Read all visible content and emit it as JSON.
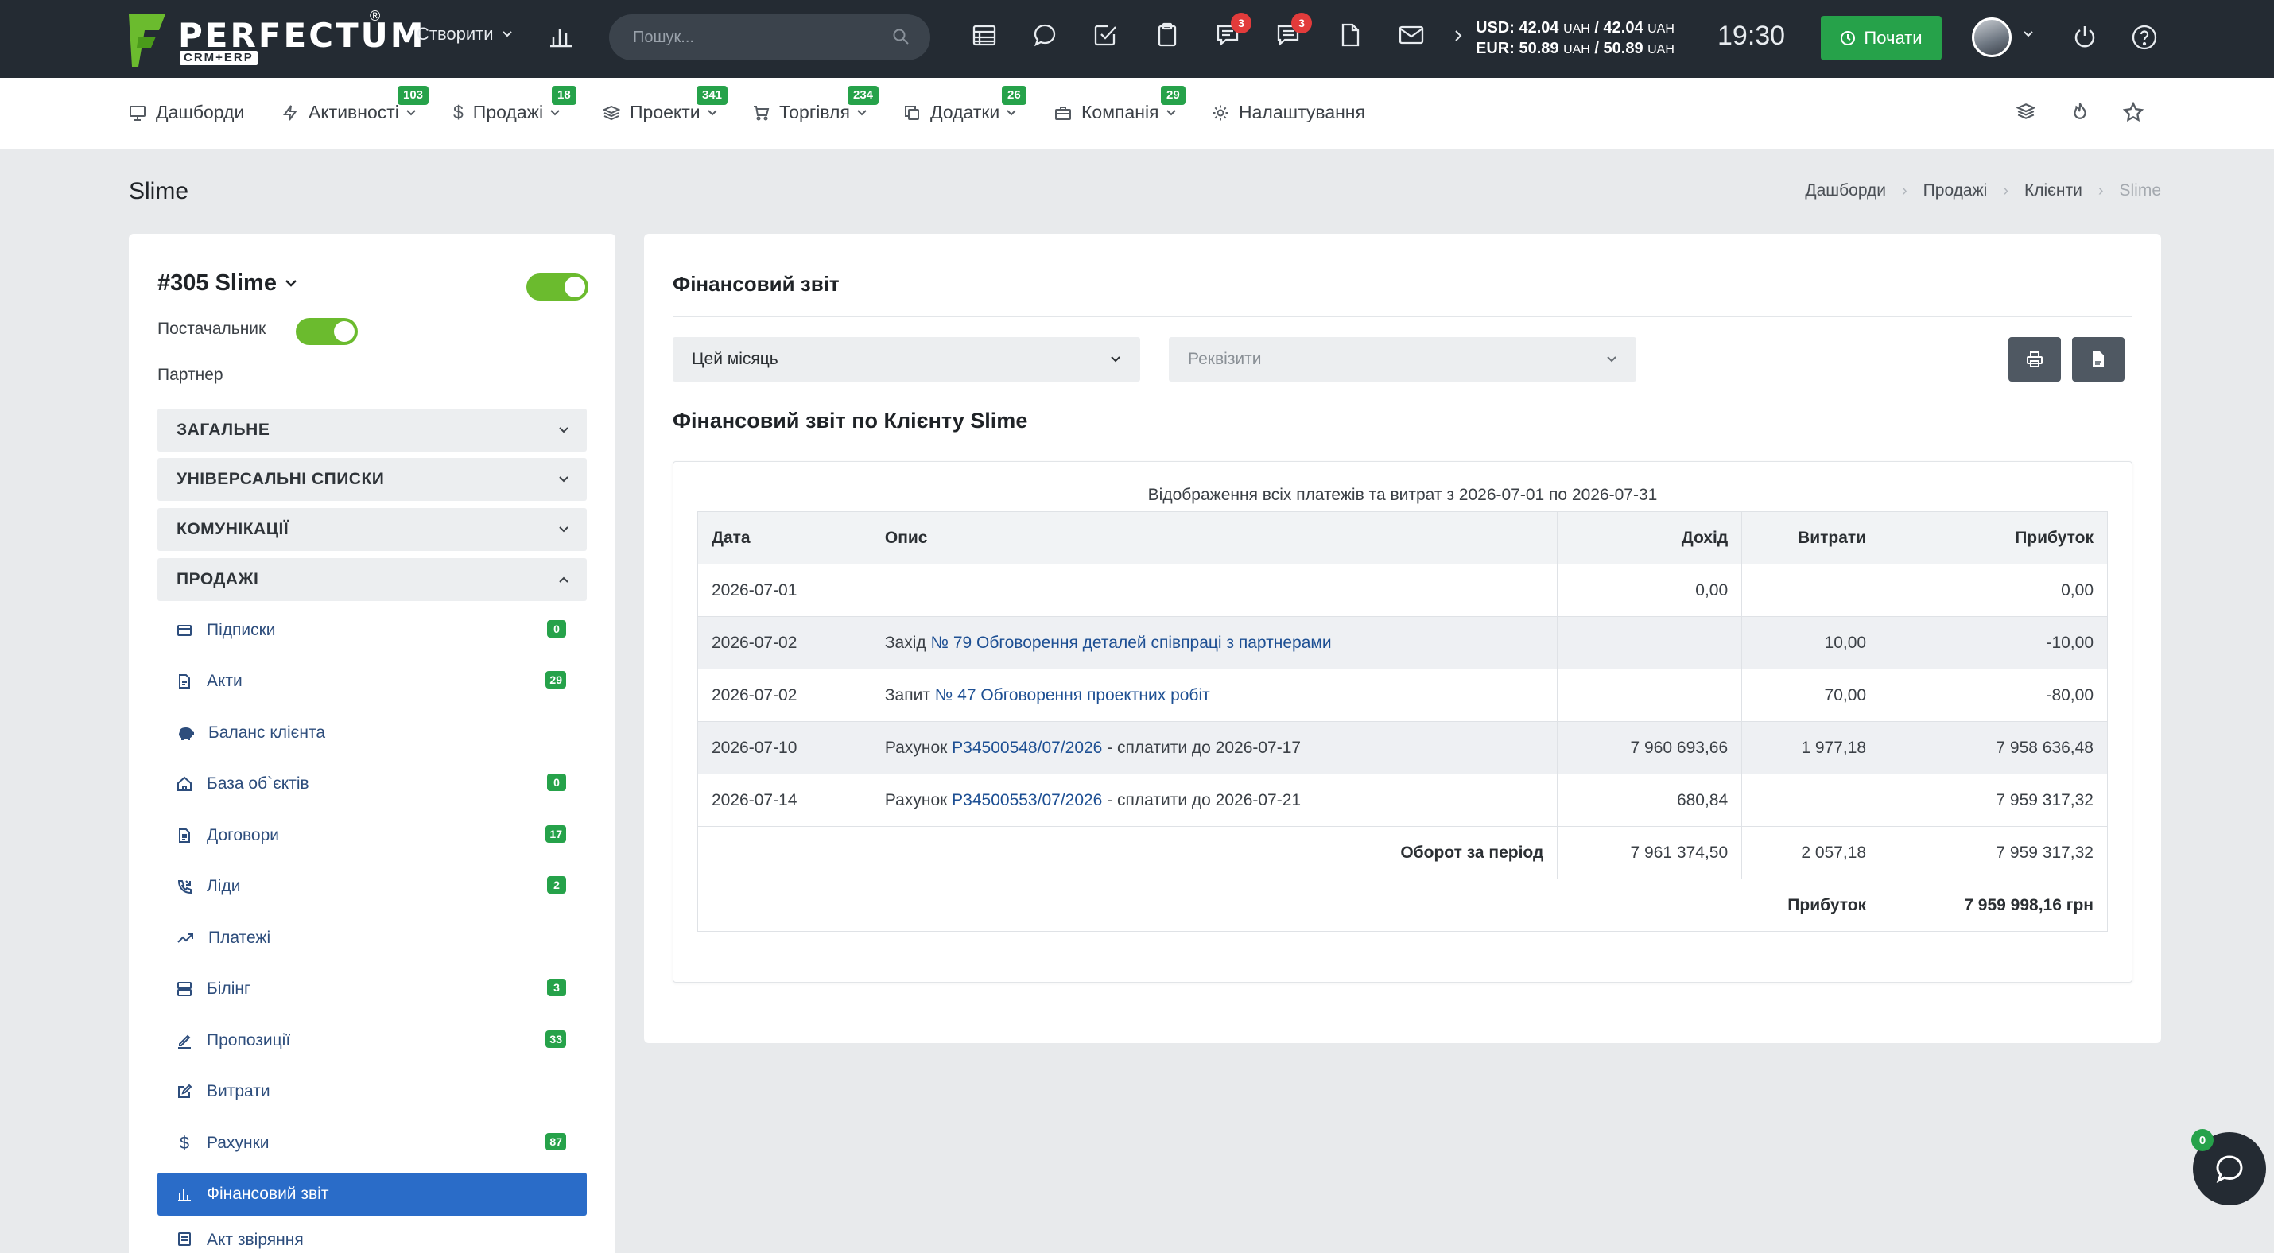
{
  "topbar": {
    "brand": "PERFECTUM",
    "brand_reg": "®",
    "brand_sub": "CRM+ERP",
    "create_label": "Створити",
    "search_placeholder": "Пошук...",
    "badges": {
      "notifications": "3",
      "messages": "3"
    },
    "currency_usd": "USD: 42.04",
    "currency_usd_rest": " / 42.04 ",
    "currency_eur": "EUR: 50.89",
    "currency_eur_rest": " / 50.89 ",
    "currency_unit": "UAH",
    "clock": "19:30",
    "start_label": "Почати",
    "colors": {
      "bg": "#242b33",
      "accent": "#26a24a",
      "badge": "#e23b3b"
    }
  },
  "nav": {
    "items": [
      {
        "label": "Дашборди",
        "icon": "monitor-icon",
        "badge": ""
      },
      {
        "label": "Активності",
        "icon": "bolt-icon",
        "badge": "103"
      },
      {
        "label": "Продажі",
        "icon": "dollar-icon",
        "badge": "18"
      },
      {
        "label": "Проекти",
        "icon": "layers-icon",
        "badge": "341"
      },
      {
        "label": "Торгівля",
        "icon": "cart-icon",
        "badge": "234"
      },
      {
        "label": "Додатки",
        "icon": "copy-icon",
        "badge": "26"
      },
      {
        "label": "Компанія",
        "icon": "briefcase-icon",
        "badge": "29"
      },
      {
        "label": "Налаштування",
        "icon": "gear-icon",
        "badge": ""
      }
    ]
  },
  "page": {
    "title": "Slime",
    "breadcrumb": [
      "Дашборди",
      "Продажі",
      "Клієнти",
      "Slime"
    ]
  },
  "client": {
    "name": "#305 Slime",
    "supplier_label": "Постачальник",
    "partner_label": "Партнер",
    "sections": [
      "ЗАГАЛЬНЕ",
      "УНІВЕРСАЛЬНІ СПИСКИ",
      "КОМУНІКАЦІЇ",
      "ПРОДАЖІ"
    ],
    "sales_items": [
      {
        "label": "Підписки",
        "badge": "0",
        "icon": "subscription-icon"
      },
      {
        "label": "Акти",
        "badge": "29",
        "icon": "document-icon"
      },
      {
        "label": "Баланс клієнта",
        "badge": "",
        "icon": "piggy-bank-icon"
      },
      {
        "label": "База об`єктів",
        "badge": "0",
        "icon": "home-icon"
      },
      {
        "label": "Договори",
        "badge": "17",
        "icon": "contract-icon"
      },
      {
        "label": "Ліди",
        "badge": "2",
        "icon": "phone-icon"
      },
      {
        "label": "Платежі",
        "badge": "",
        "icon": "trend-up-icon"
      },
      {
        "label": "Білінг",
        "badge": "3",
        "icon": "server-icon"
      },
      {
        "label": "Пропозиції",
        "badge": "33",
        "icon": "pen-icon"
      },
      {
        "label": "Витрати",
        "badge": "",
        "icon": "edit-icon"
      },
      {
        "label": "Рахунки",
        "badge": "87",
        "icon": "dollar-icon"
      },
      {
        "label": "Фінансовий звіт",
        "badge": "",
        "icon": "chart-icon"
      },
      {
        "label": "Акт звіряння",
        "badge": "",
        "icon": "list-icon"
      }
    ]
  },
  "report": {
    "title": "Фінансовий звіт",
    "period_value": "Цей місяць",
    "requisites_placeholder": "Реквізити",
    "subtitle": "Фінансовий звіт по Клієнту Slime",
    "caption": "Відображення всіх платежів та витрат з 2026-07-01 по 2026-07-31",
    "columns": [
      "Дата",
      "Опис",
      "Дохід",
      "Витрати",
      "Прибуток"
    ],
    "rows": [
      {
        "date": "2026-07-01",
        "desc_prefix": "",
        "desc_link": "",
        "desc_suffix": "",
        "income": "0,00",
        "expense": "",
        "profit": "0,00"
      },
      {
        "date": "2026-07-02",
        "desc_prefix": "Захід ",
        "desc_link": "№ 79 Обговорення деталей співпраці з партнерами",
        "desc_suffix": "",
        "income": "",
        "expense": "10,00",
        "profit": "-10,00"
      },
      {
        "date": "2026-07-02",
        "desc_prefix": "Запит ",
        "desc_link": "№ 47 Обговорення проектних робіт",
        "desc_suffix": "",
        "income": "",
        "expense": "70,00",
        "profit": "-80,00"
      },
      {
        "date": "2026-07-10",
        "desc_prefix": "Рахунок ",
        "desc_link": "P34500548/07/2026",
        "desc_suffix": " - сплатити до 2026-07-17",
        "income": "7 960 693,66",
        "expense": "1 977,18",
        "profit": "7 958 636,48"
      },
      {
        "date": "2026-07-14",
        "desc_prefix": "Рахунок ",
        "desc_link": "P34500553/07/2026",
        "desc_suffix": " - сплатити до 2026-07-21",
        "income": "680,84",
        "expense": "",
        "profit": "7 959 317,32"
      }
    ],
    "turnover_label": "Оборот за період",
    "turnover": {
      "income": "7 961 374,50",
      "expense": "2 057,18",
      "profit": "7 959 317,32"
    },
    "profit_label": "Прибуток",
    "profit_total": "7 959 998,16 грн"
  },
  "chat": {
    "badge": "0"
  }
}
